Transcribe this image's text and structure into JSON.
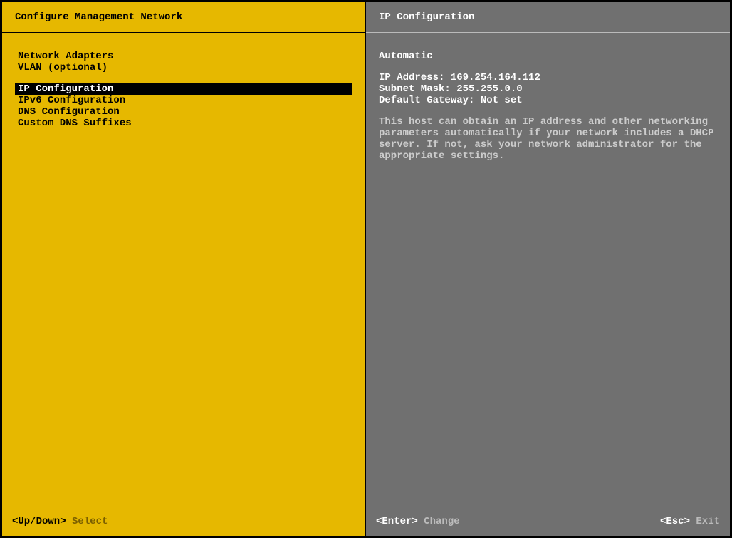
{
  "left": {
    "title": "Configure Management Network",
    "group1": [
      "Network Adapters",
      "VLAN (optional)"
    ],
    "group2": [
      "IP Configuration",
      "IPv6 Configuration",
      "DNS Configuration",
      "Custom DNS Suffixes"
    ],
    "selected": "IP Configuration",
    "footer": {
      "key": "<Up/Down>",
      "action": "Select"
    }
  },
  "right": {
    "title": "IP Configuration",
    "mode": "Automatic",
    "ip_label": "IP Address:",
    "ip_value": "169.254.164.112",
    "mask_label": "Subnet Mask:",
    "mask_value": "255.255.0.0",
    "gw_label": "Default Gateway:",
    "gw_value": "Not set",
    "help": "This host can obtain an IP address and other networking parameters automatically if your network includes a DHCP server. If not, ask your network administrator for the appropriate settings.",
    "footer": {
      "enter_key": "<Enter>",
      "enter_action": "Change",
      "esc_key": "<Esc>",
      "esc_action": "Exit"
    }
  }
}
